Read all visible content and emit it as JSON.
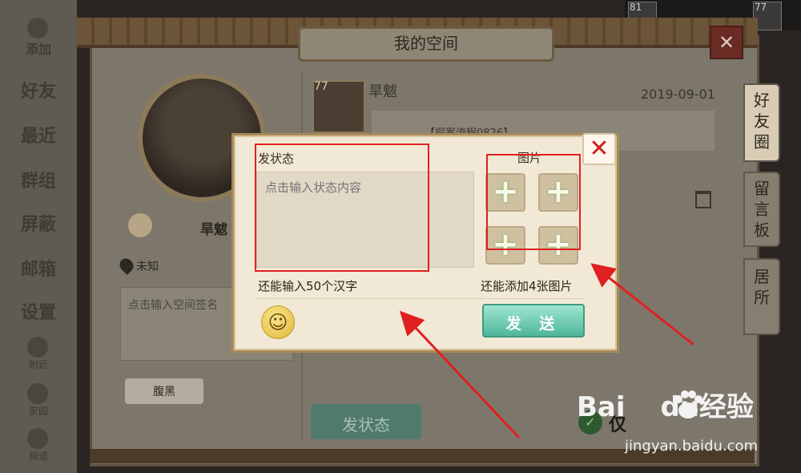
{
  "left_nav": {
    "items": [
      "添加",
      "好友",
      "最近",
      "群组",
      "屏蔽",
      "邮箱",
      "设置"
    ],
    "small_items": [
      "附近",
      "家园",
      "频道"
    ]
  },
  "window": {
    "title": "我的空间",
    "close_icon": "close-icon"
  },
  "profile": {
    "name": "旱魃",
    "location": "未知",
    "signature_placeholder": "点击输入空间签名",
    "tag": "腹黑"
  },
  "feed": {
    "level": "77",
    "name": "旱魃",
    "date": "2019-09-01",
    "post_preview": "【探案流程0826】"
  },
  "side_tabs": [
    "好友圈",
    "留言板",
    "居所"
  ],
  "hud": {
    "levels": [
      "81",
      "77"
    ]
  },
  "footer": {
    "post_status_button": "发状态",
    "check_label": "仅"
  },
  "dialog": {
    "status_label": "发状态",
    "status_placeholder": "点击输入状态内容",
    "picture_label": "图片",
    "remaining_chars": "还能输入50个汉字",
    "remaining_pics": "还能添加4张图片",
    "send_button": "发 送"
  },
  "watermark": {
    "brand": "Bai",
    "brand_suffix": "du经验",
    "url": "jingyan.baidu.com"
  },
  "colors": {
    "annotation_red": "#e02020",
    "send_green": "#4fb69a",
    "dialog_bg": "#f1e9d6"
  }
}
